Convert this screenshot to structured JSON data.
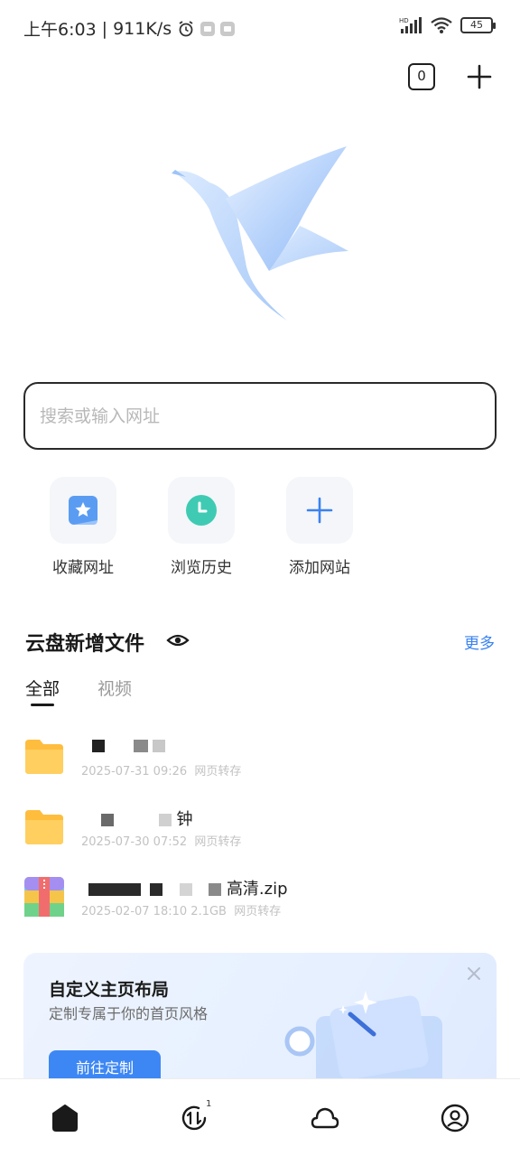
{
  "status_bar": {
    "time": "上午6:03",
    "net_speed": "911K/s",
    "battery": "45"
  },
  "top_bar": {
    "tab_count": "0"
  },
  "search": {
    "placeholder": "搜索或输入网址"
  },
  "shortcuts": [
    {
      "label": "收藏网址",
      "icon": "bookmark-star-icon"
    },
    {
      "label": "浏览历史",
      "icon": "history-clock-icon"
    },
    {
      "label": "添加网站",
      "icon": "plus-icon"
    }
  ],
  "cloud": {
    "title": "云盘新增文件",
    "more": "更多",
    "tabs": [
      "全部",
      "视频"
    ],
    "files": [
      {
        "name_visible": "",
        "date_visible": "2025-07-31 09:26",
        "source": "网页转存",
        "icon": "folder-icon"
      },
      {
        "name_visible": "钟",
        "date_visible": "2025-07-30 07:52",
        "source": "网页转存",
        "icon": "folder-icon"
      },
      {
        "name_visible": "高清.zip",
        "date_visible": "2025-02-07 18:10",
        "size": "2.1GB",
        "source": "网页转存",
        "icon": "zip-archive-icon"
      }
    ]
  },
  "custom_card": {
    "title": "自定义主页布局",
    "subtitle": "定制专属于你的首页风格",
    "button": "前往定制"
  },
  "bottom_nav": {
    "badge": "1",
    "items": [
      "home-icon",
      "transfer-icon",
      "cloud-icon",
      "profile-icon"
    ]
  },
  "colors": {
    "accent": "#3d87f5",
    "link": "#3a82f0",
    "folder": "#ffc94d"
  }
}
